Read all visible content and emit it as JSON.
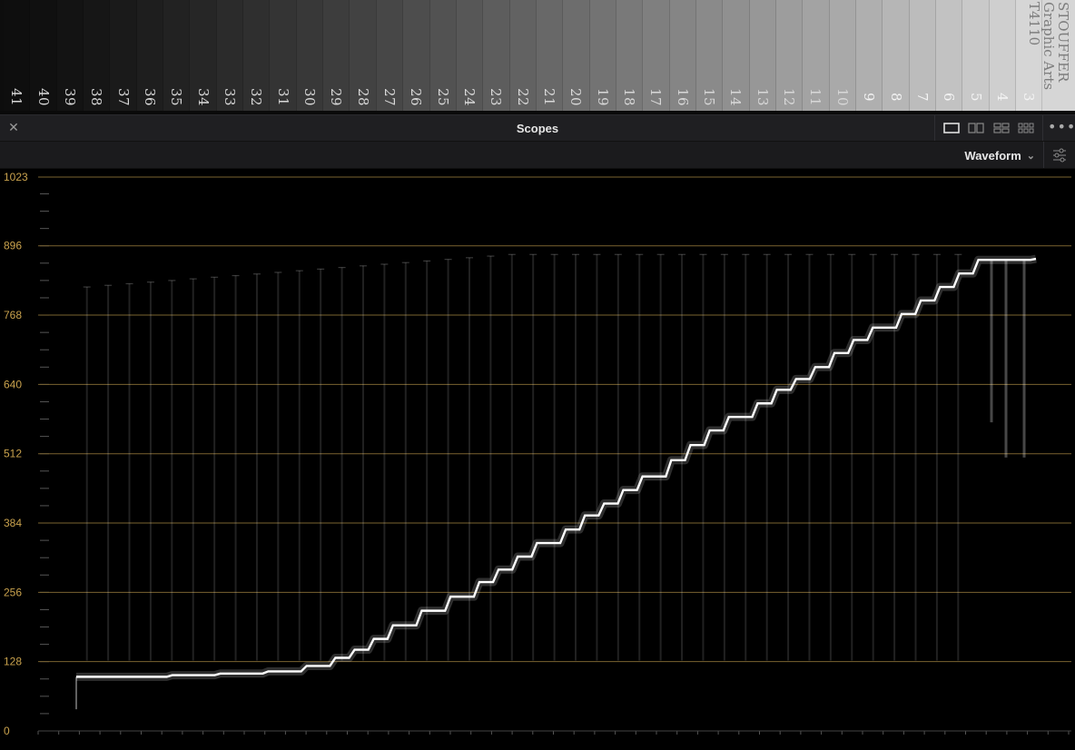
{
  "wedge": {
    "step_numbers": [
      "41",
      "40",
      "39",
      "38",
      "37",
      "36",
      "35",
      "34",
      "33",
      "32",
      "31",
      "30",
      "29",
      "28",
      "27",
      "26",
      "25",
      "24",
      "23",
      "22",
      "21",
      "20",
      "19",
      "18",
      "17",
      "16",
      "15",
      "14",
      "13",
      "12",
      "11",
      "10",
      "9",
      "8",
      "7",
      "6",
      "5",
      "4",
      "3"
    ],
    "brand_lines": [
      "STOUFFER",
      "Graphic Arts",
      "T4110"
    ]
  },
  "titlebar": {
    "title": "Scopes",
    "close_icon": "close-icon",
    "layout_icons": [
      "layout-single-icon",
      "layout-2up-icon",
      "layout-4up-icon",
      "layout-grid-icon"
    ],
    "more_icon": "more-options-icon"
  },
  "toolbar": {
    "scope_type": "Waveform",
    "dropdown_icon": "chevron-down-icon",
    "settings_icon": "settings-sliders-icon"
  },
  "chart_data": {
    "type": "line",
    "title": "",
    "xlabel": "",
    "ylabel": "",
    "y_ticks": [
      0,
      128,
      256,
      384,
      512,
      640,
      768,
      896,
      1023
    ],
    "ylim": [
      0,
      1023
    ],
    "xlim": [
      0,
      1
    ],
    "grid": true,
    "colors": {
      "grid": "#7a6330",
      "label": "#c9a24d",
      "trace": "#ffffff"
    },
    "series": [
      {
        "values": [
          [
            0.0,
            100
          ],
          [
            0.05,
            100
          ],
          [
            0.1,
            103
          ],
          [
            0.15,
            106
          ],
          [
            0.2,
            110
          ],
          [
            0.24,
            120
          ],
          [
            0.27,
            135
          ],
          [
            0.29,
            150
          ],
          [
            0.31,
            170
          ],
          [
            0.33,
            195
          ],
          [
            0.36,
            222
          ],
          [
            0.39,
            248
          ],
          [
            0.42,
            275
          ],
          [
            0.44,
            298
          ],
          [
            0.46,
            322
          ],
          [
            0.48,
            347
          ],
          [
            0.51,
            372
          ],
          [
            0.53,
            398
          ],
          [
            0.55,
            420
          ],
          [
            0.57,
            445
          ],
          [
            0.59,
            470
          ],
          [
            0.62,
            500
          ],
          [
            0.64,
            528
          ],
          [
            0.66,
            555
          ],
          [
            0.68,
            580
          ],
          [
            0.71,
            605
          ],
          [
            0.73,
            630
          ],
          [
            0.75,
            650
          ],
          [
            0.77,
            672
          ],
          [
            0.79,
            698
          ],
          [
            0.81,
            722
          ],
          [
            0.83,
            745
          ],
          [
            0.86,
            770
          ],
          [
            0.88,
            795
          ],
          [
            0.9,
            820
          ],
          [
            0.92,
            845
          ],
          [
            0.94,
            870
          ],
          [
            1.0,
            872
          ]
        ]
      }
    ]
  }
}
